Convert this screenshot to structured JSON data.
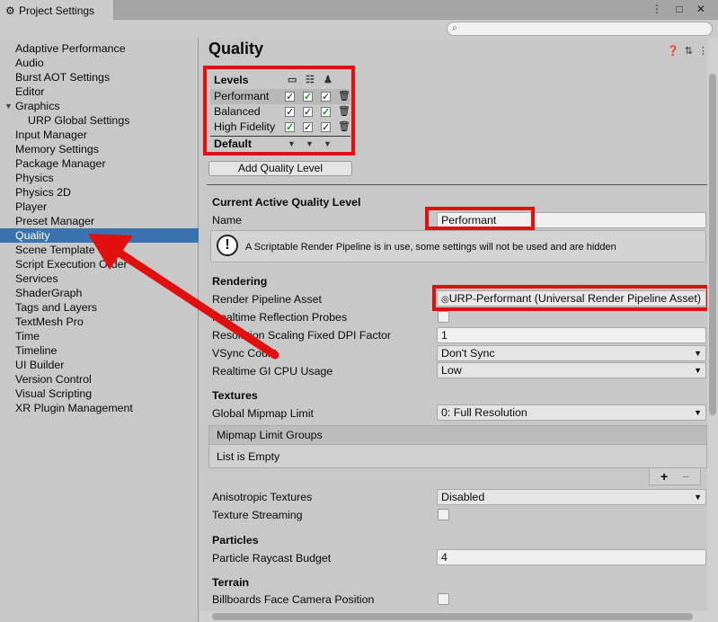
{
  "window": {
    "tab_title": "Project Settings",
    "controls": "⋮ □ ✕"
  },
  "sidebar": {
    "items": [
      "Adaptive Performance",
      "Audio",
      "Burst AOT Settings",
      "Editor",
      "Graphics",
      "URP Global Settings",
      "Input Manager",
      "Memory Settings",
      "Package Manager",
      "Physics",
      "Physics 2D",
      "Player",
      "Preset Manager",
      "Quality",
      "Scene Template",
      "Script Execution Order",
      "Services",
      "ShaderGraph",
      "Tags and Layers",
      "TextMesh Pro",
      "Time",
      "Timeline",
      "UI Builder",
      "Version Control",
      "Visual Scripting",
      "XR Plugin Management"
    ],
    "selected": "Quality"
  },
  "main": {
    "title": "Quality",
    "levels": {
      "header": "Levels",
      "rows": [
        {
          "name": "Performant",
          "checks": [
            "✓",
            "✓",
            "✓"
          ]
        },
        {
          "name": "Balanced",
          "checks": [
            "✓",
            "✓",
            "✓"
          ]
        },
        {
          "name": "High Fidelity",
          "checks": [
            "✓",
            "✓",
            "✓"
          ]
        }
      ],
      "default_label": "Default"
    },
    "add_button": "Add Quality Level",
    "current_section": "Current Active Quality Level",
    "name_label": "Name",
    "name_value": "Performant",
    "help_text": "A Scriptable Render Pipeline is in use, some settings will not be used and are hidden",
    "rendering": {
      "header": "Rendering",
      "pipeline_label": "Render Pipeline Asset",
      "pipeline_value": "URP-Performant (Universal Render Pipeline Asset)",
      "reflection_label": "Realtime Reflection Probes",
      "dpi_label": "Resolution Scaling Fixed DPI Factor",
      "dpi_value": "1",
      "vsync_label": "VSync Count",
      "vsync_value": "Don't Sync",
      "gi_label": "Realtime GI CPU Usage",
      "gi_value": "Low"
    },
    "textures": {
      "header": "Textures",
      "mip_label": "Global Mipmap Limit",
      "mip_value": "0: Full Resolution",
      "groups_header": "Mipmap Limit Groups",
      "groups_empty": "List is Empty",
      "add": "+",
      "remove": "−",
      "aniso_label": "Anisotropic Textures",
      "aniso_value": "Disabled",
      "streaming_label": "Texture Streaming"
    },
    "particles": {
      "header": "Particles",
      "raycast_label": "Particle Raycast Budget",
      "raycast_value": "4"
    },
    "terrain": {
      "header": "Terrain",
      "billboard_label": "Billboards Face Camera Position"
    }
  },
  "colors": {
    "selection": "#3a72b0",
    "annotation_red": "#e01010",
    "check_green": "#1b9a1b"
  }
}
